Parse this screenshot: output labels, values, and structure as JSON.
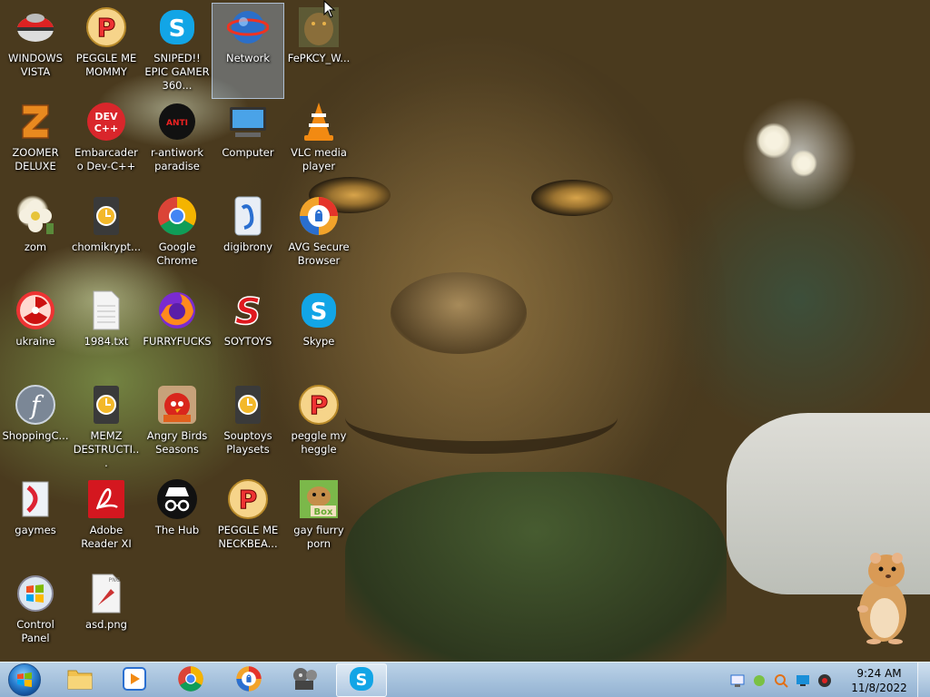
{
  "desktop": {
    "icons": [
      {
        "label": "WINDOWS VISTA",
        "icon": "pokeball-icon"
      },
      {
        "label": "PEGGLE ME MOMMY",
        "icon": "peggle-icon"
      },
      {
        "label": "SNIPED!! EPIC GAMER 360...",
        "icon": "skype-icon"
      },
      {
        "label": "Network",
        "icon": "network-globe-icon"
      },
      {
        "label": "FePKCY_W...",
        "icon": "wise-tree-thumbnail-icon"
      },
      {
        "label": "ZOOMER DELUXE",
        "icon": "zuma-icon"
      },
      {
        "label": "Embarcadero Dev-C++",
        "icon": "devcpp-icon"
      },
      {
        "label": "r-antiwork paradise",
        "icon": "antiwork-icon"
      },
      {
        "label": "Computer",
        "icon": "computer-icon"
      },
      {
        "label": "VLC media player",
        "icon": "vlc-cone-icon"
      },
      {
        "label": "zom",
        "icon": "flower-icon"
      },
      {
        "label": "chomikrypt...",
        "icon": "shortcut-clock-icon"
      },
      {
        "label": "Google Chrome",
        "icon": "chrome-icon"
      },
      {
        "label": "digibrony",
        "icon": "digibrony-icon"
      },
      {
        "label": "AVG Secure Browser",
        "icon": "avg-browser-icon"
      },
      {
        "label": "ukraine",
        "icon": "radiation-icon"
      },
      {
        "label": "1984.txt",
        "icon": "text-file-icon"
      },
      {
        "label": "FURRYFUCKS",
        "icon": "firefox-icon"
      },
      {
        "label": "SOYTOYS",
        "icon": "soytoys-icon"
      },
      {
        "label": "Skype",
        "icon": "skype-icon"
      },
      {
        "label": "ShoppingC...",
        "icon": "flash-icon"
      },
      {
        "label": "MEMZ DESTRUCTI...",
        "icon": "shortcut-clock-icon"
      },
      {
        "label": "Angry Birds Seasons",
        "icon": "angry-birds-icon"
      },
      {
        "label": "Souptoys Playsets",
        "icon": "shortcut-clock-icon"
      },
      {
        "label": "peggle my heggle",
        "icon": "peggle-icon"
      },
      {
        "label": "gaymes",
        "icon": "games-folder-icon"
      },
      {
        "label": "Adobe Reader XI",
        "icon": "adobe-reader-icon"
      },
      {
        "label": "The Hub",
        "icon": "incognito-icon"
      },
      {
        "label": "PEGGLE ME NECKBEA...",
        "icon": "peggle-icon"
      },
      {
        "label": "gay fiurry porn",
        "icon": "hamster-box-icon"
      },
      {
        "label": "Control Panel",
        "icon": "control-panel-icon"
      },
      {
        "label": "asd.png",
        "icon": "png-file-icon"
      }
    ]
  },
  "taskbar": {
    "pinned": [
      {
        "name": "explorer",
        "icon": "folder-icon"
      },
      {
        "name": "media-player",
        "icon": "media-player-icon"
      },
      {
        "name": "chrome",
        "icon": "chrome-icon"
      },
      {
        "name": "avg-browser",
        "icon": "avg-browser-icon"
      },
      {
        "name": "movie-maker",
        "icon": "film-reel-icon"
      },
      {
        "name": "skype",
        "icon": "skype-icon"
      }
    ],
    "tray_icons": [
      "network-icon",
      "app-tray-icon",
      "search-tray-icon",
      "monitor-tray-icon",
      "volume-tray-icon"
    ],
    "time": "9:24 AM",
    "date": "11/8/2022"
  },
  "colors": {
    "taskbar_top": "#bcd3e8",
    "taskbar_bottom": "#93b2d2",
    "selection": "#aac8f0"
  }
}
